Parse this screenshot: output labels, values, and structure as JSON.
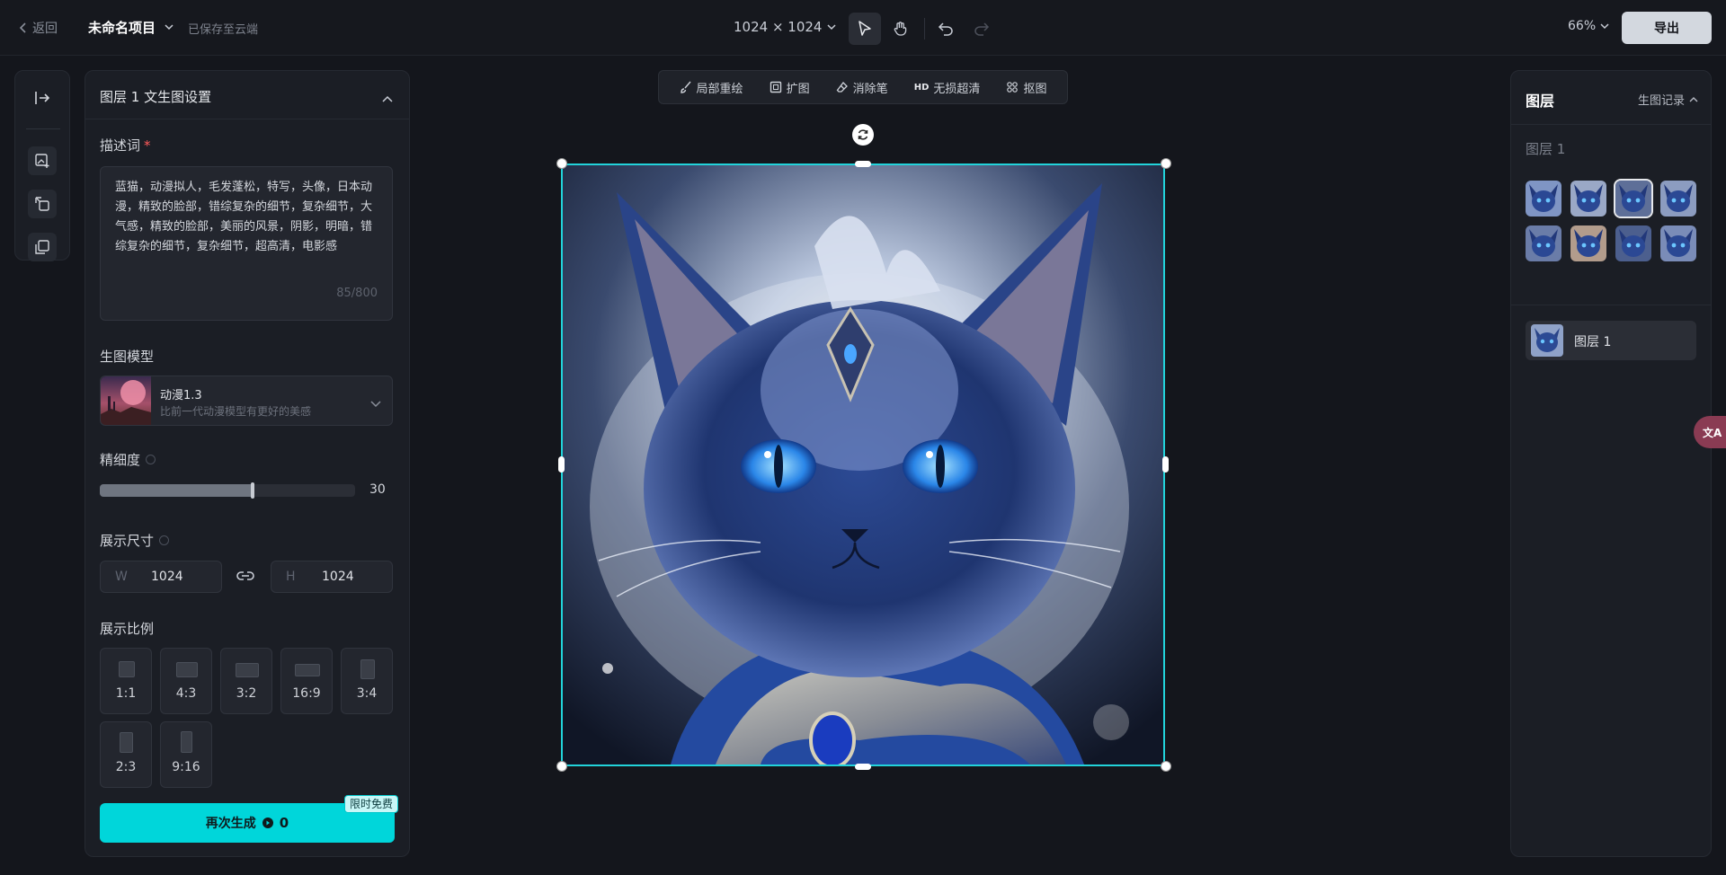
{
  "topbar": {
    "back_label": "返回",
    "project_name": "未命名项目",
    "saved_status": "已保存至云端",
    "canvas_size": "1024 × 1024",
    "zoom": "66%",
    "export_label": "导出"
  },
  "edit_tools": [
    {
      "label": "局部重绘",
      "icon": "brush-icon"
    },
    {
      "label": "扩图",
      "icon": "expand-icon"
    },
    {
      "label": "消除笔",
      "icon": "eraser-icon"
    },
    {
      "label": "无损超清",
      "icon": "hd-icon",
      "tag": "HD"
    },
    {
      "label": "抠图",
      "icon": "cutout-icon"
    }
  ],
  "settings": {
    "title": "图层 1 文生图设置",
    "prompt_label": "描述词",
    "prompt_required": "*",
    "prompt_text": "蓝猫，动漫拟人，毛发蓬松，特写，头像，日本动漫，精致的脸部，错综复杂的细节，复杂细节，大气感，精致的脸部，美丽的风景，阴影，明暗，错综复杂的细节，复杂细节，超高清，电影感",
    "prompt_count": "85/800",
    "model_label": "生图模型",
    "model_name": "动漫1.3",
    "model_desc": "比前一代动漫模型有更好的美感",
    "detail_label": "精细度",
    "detail_value": "30",
    "detail_fraction": 0.6,
    "size_label": "展示尺寸",
    "width_prefix": "W",
    "width_value": "1024",
    "height_prefix": "H",
    "height_value": "1024",
    "ratio_label": "展示比例",
    "ratios": [
      "1:1",
      "4:3",
      "3:2",
      "16:9",
      "3:4",
      "2:3",
      "9:16"
    ],
    "generate_label": "再次生成",
    "generate_cost": "0",
    "free_badge": "限时免费"
  },
  "layers": {
    "title": "图层",
    "history_label": "生图记录",
    "group_label": "图层 1",
    "layer_name": "图层 1",
    "thumb_count": 8,
    "selected_thumb": 2
  },
  "translate_badge": "文A",
  "colors": {
    "accent": "#00d6da",
    "selection": "#22d3da",
    "background": "#14161c"
  }
}
